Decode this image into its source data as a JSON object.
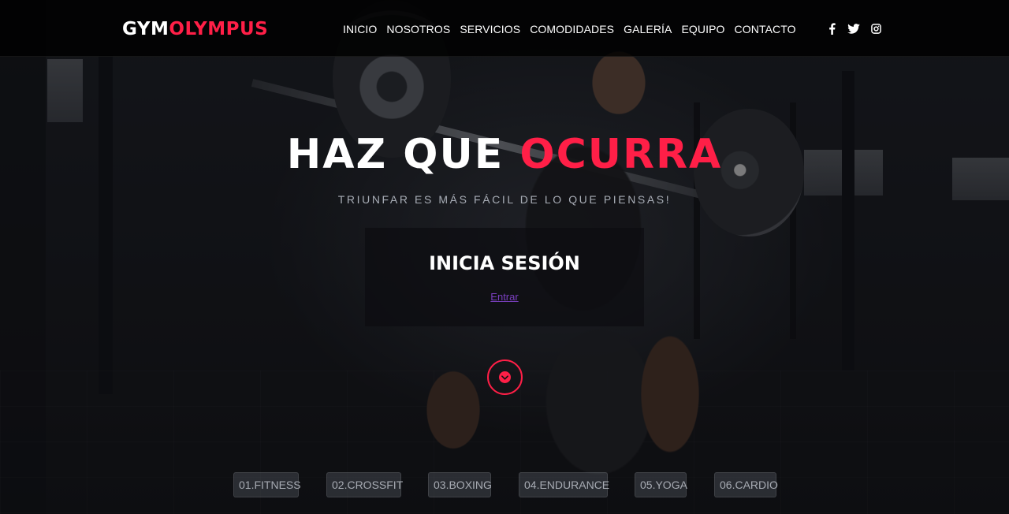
{
  "brand": {
    "part1": "GYM",
    "part2": "OLYMPUS"
  },
  "nav": {
    "items": [
      {
        "label": "INICIO"
      },
      {
        "label": "NOSOTROS"
      },
      {
        "label": "SERVICIOS"
      },
      {
        "label": "COMODIDADES"
      },
      {
        "label": "GALERÍA"
      },
      {
        "label": "EQUIPO"
      },
      {
        "label": "CONTACTO"
      }
    ]
  },
  "social": [
    {
      "icon": "facebook-icon"
    },
    {
      "icon": "twitter-icon"
    },
    {
      "icon": "instagram-icon"
    }
  ],
  "hero": {
    "title_white": "HAZ QUE",
    "title_red": "OCURRA",
    "subtitle": "TRIUNFAR ES MÁS FÁCIL DE LO QUE PIENSAS!"
  },
  "login": {
    "title": "INICIA SESIÓN",
    "link": "Entrar"
  },
  "scroll_button": {
    "icon": "chevron-down-icon"
  },
  "services": [
    {
      "label": "01.FITNESS"
    },
    {
      "label": "02.CROSSFIT"
    },
    {
      "label": "03.BOXING"
    },
    {
      "label": "04.ENDURANCE"
    },
    {
      "label": "05.YOGA"
    },
    {
      "label": "06.CARDIO"
    }
  ],
  "colors": {
    "accent": "#ff1f47",
    "link": "#7a3fbf",
    "header_bg": "#000000"
  }
}
